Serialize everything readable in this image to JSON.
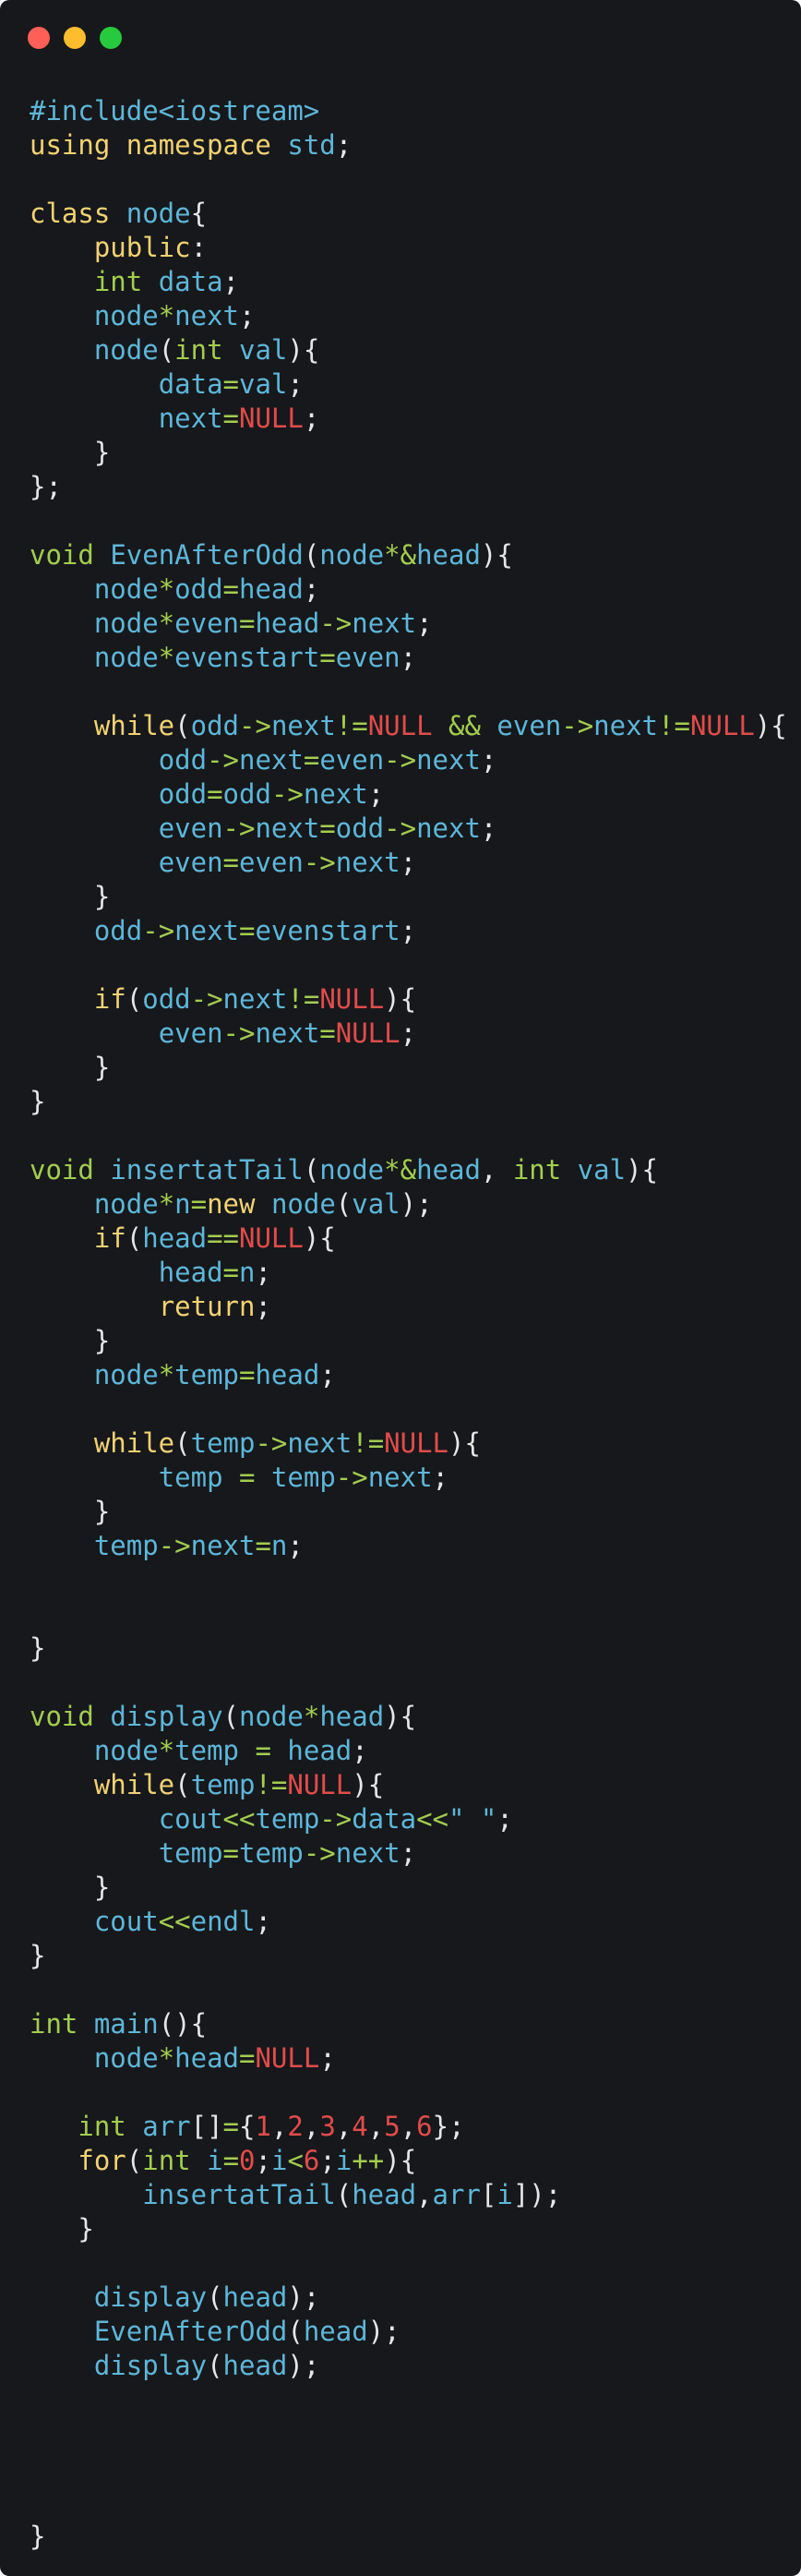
{
  "window": {
    "controls": [
      {
        "name": "close",
        "color": "#ff5f56"
      },
      {
        "name": "minimize",
        "color": "#ffbd2e"
      },
      {
        "name": "zoom",
        "color": "#27c93f"
      }
    ]
  },
  "colors": {
    "p": "#e6e6e6",
    "b": "#5eb6d9",
    "y": "#f2d272",
    "g": "#a3cd4f",
    "r": "#e24b4b",
    "background": "#16181b"
  },
  "code_lines": [
    [
      [
        "b",
        "#include<iostream>"
      ]
    ],
    [
      [
        "y",
        "using namespace "
      ],
      [
        "b",
        "std"
      ],
      [
        "p",
        ";"
      ]
    ],
    [],
    [
      [
        "y",
        "class "
      ],
      [
        "b",
        "node"
      ],
      [
        "p",
        "{"
      ]
    ],
    [
      [
        "p",
        "    "
      ],
      [
        "y",
        "public"
      ],
      [
        "p",
        ":"
      ]
    ],
    [
      [
        "p",
        "    "
      ],
      [
        "g",
        "int "
      ],
      [
        "b",
        "data"
      ],
      [
        "p",
        ";"
      ]
    ],
    [
      [
        "p",
        "    "
      ],
      [
        "b",
        "node"
      ],
      [
        "g",
        "*"
      ],
      [
        "b",
        "next"
      ],
      [
        "p",
        ";"
      ]
    ],
    [
      [
        "p",
        "    "
      ],
      [
        "b",
        "node"
      ],
      [
        "p",
        "("
      ],
      [
        "g",
        "int "
      ],
      [
        "b",
        "val"
      ],
      [
        "p",
        "){"
      ]
    ],
    [
      [
        "p",
        "        "
      ],
      [
        "b",
        "data"
      ],
      [
        "g",
        "="
      ],
      [
        "b",
        "val"
      ],
      [
        "p",
        ";"
      ]
    ],
    [
      [
        "p",
        "        "
      ],
      [
        "b",
        "next"
      ],
      [
        "g",
        "="
      ],
      [
        "r",
        "NULL"
      ],
      [
        "p",
        ";"
      ]
    ],
    [
      [
        "p",
        "    }"
      ]
    ],
    [
      [
        "p",
        "};"
      ]
    ],
    [],
    [
      [
        "g",
        "void "
      ],
      [
        "b",
        "EvenAfterOdd"
      ],
      [
        "p",
        "("
      ],
      [
        "b",
        "node"
      ],
      [
        "g",
        "*&"
      ],
      [
        "b",
        "head"
      ],
      [
        "p",
        "){"
      ]
    ],
    [
      [
        "p",
        "    "
      ],
      [
        "b",
        "node"
      ],
      [
        "g",
        "*"
      ],
      [
        "b",
        "odd"
      ],
      [
        "g",
        "="
      ],
      [
        "b",
        "head"
      ],
      [
        "p",
        ";"
      ]
    ],
    [
      [
        "p",
        "    "
      ],
      [
        "b",
        "node"
      ],
      [
        "g",
        "*"
      ],
      [
        "b",
        "even"
      ],
      [
        "g",
        "="
      ],
      [
        "b",
        "head"
      ],
      [
        "g",
        "->"
      ],
      [
        "b",
        "next"
      ],
      [
        "p",
        ";"
      ]
    ],
    [
      [
        "p",
        "    "
      ],
      [
        "b",
        "node"
      ],
      [
        "g",
        "*"
      ],
      [
        "b",
        "evenstart"
      ],
      [
        "g",
        "="
      ],
      [
        "b",
        "even"
      ],
      [
        "p",
        ";"
      ]
    ],
    [],
    [
      [
        "p",
        "    "
      ],
      [
        "y",
        "while"
      ],
      [
        "p",
        "("
      ],
      [
        "b",
        "odd"
      ],
      [
        "g",
        "->"
      ],
      [
        "b",
        "next"
      ],
      [
        "g",
        "!="
      ],
      [
        "r",
        "NULL"
      ],
      [
        "p",
        " "
      ],
      [
        "g",
        "&&"
      ],
      [
        "p",
        " "
      ],
      [
        "b",
        "even"
      ],
      [
        "g",
        "->"
      ],
      [
        "b",
        "next"
      ],
      [
        "g",
        "!="
      ],
      [
        "r",
        "NULL"
      ],
      [
        "p",
        "){"
      ]
    ],
    [
      [
        "p",
        "        "
      ],
      [
        "b",
        "odd"
      ],
      [
        "g",
        "->"
      ],
      [
        "b",
        "next"
      ],
      [
        "g",
        "="
      ],
      [
        "b",
        "even"
      ],
      [
        "g",
        "->"
      ],
      [
        "b",
        "next"
      ],
      [
        "p",
        ";"
      ]
    ],
    [
      [
        "p",
        "        "
      ],
      [
        "b",
        "odd"
      ],
      [
        "g",
        "="
      ],
      [
        "b",
        "odd"
      ],
      [
        "g",
        "->"
      ],
      [
        "b",
        "next"
      ],
      [
        "p",
        ";"
      ]
    ],
    [
      [
        "p",
        "        "
      ],
      [
        "b",
        "even"
      ],
      [
        "g",
        "->"
      ],
      [
        "b",
        "next"
      ],
      [
        "g",
        "="
      ],
      [
        "b",
        "odd"
      ],
      [
        "g",
        "->"
      ],
      [
        "b",
        "next"
      ],
      [
        "p",
        ";"
      ]
    ],
    [
      [
        "p",
        "        "
      ],
      [
        "b",
        "even"
      ],
      [
        "g",
        "="
      ],
      [
        "b",
        "even"
      ],
      [
        "g",
        "->"
      ],
      [
        "b",
        "next"
      ],
      [
        "p",
        ";"
      ]
    ],
    [
      [
        "p",
        "    }"
      ]
    ],
    [
      [
        "p",
        "    "
      ],
      [
        "b",
        "odd"
      ],
      [
        "g",
        "->"
      ],
      [
        "b",
        "next"
      ],
      [
        "g",
        "="
      ],
      [
        "b",
        "evenstart"
      ],
      [
        "p",
        ";"
      ]
    ],
    [],
    [
      [
        "p",
        "    "
      ],
      [
        "y",
        "if"
      ],
      [
        "p",
        "("
      ],
      [
        "b",
        "odd"
      ],
      [
        "g",
        "->"
      ],
      [
        "b",
        "next"
      ],
      [
        "g",
        "!="
      ],
      [
        "r",
        "NULL"
      ],
      [
        "p",
        "){"
      ]
    ],
    [
      [
        "p",
        "        "
      ],
      [
        "b",
        "even"
      ],
      [
        "g",
        "->"
      ],
      [
        "b",
        "next"
      ],
      [
        "g",
        "="
      ],
      [
        "r",
        "NULL"
      ],
      [
        "p",
        ";"
      ]
    ],
    [
      [
        "p",
        "    }"
      ]
    ],
    [
      [
        "p",
        "}"
      ]
    ],
    [],
    [
      [
        "g",
        "void "
      ],
      [
        "b",
        "insertatTail"
      ],
      [
        "p",
        "("
      ],
      [
        "b",
        "node"
      ],
      [
        "g",
        "*&"
      ],
      [
        "b",
        "head"
      ],
      [
        "p",
        ", "
      ],
      [
        "g",
        "int "
      ],
      [
        "b",
        "val"
      ],
      [
        "p",
        "){"
      ]
    ],
    [
      [
        "p",
        "    "
      ],
      [
        "b",
        "node"
      ],
      [
        "g",
        "*"
      ],
      [
        "b",
        "n"
      ],
      [
        "g",
        "="
      ],
      [
        "y",
        "new "
      ],
      [
        "b",
        "node"
      ],
      [
        "p",
        "("
      ],
      [
        "b",
        "val"
      ],
      [
        "p",
        ");"
      ]
    ],
    [
      [
        "p",
        "    "
      ],
      [
        "y",
        "if"
      ],
      [
        "p",
        "("
      ],
      [
        "b",
        "head"
      ],
      [
        "g",
        "=="
      ],
      [
        "r",
        "NULL"
      ],
      [
        "p",
        "){"
      ]
    ],
    [
      [
        "p",
        "        "
      ],
      [
        "b",
        "head"
      ],
      [
        "g",
        "="
      ],
      [
        "b",
        "n"
      ],
      [
        "p",
        ";"
      ]
    ],
    [
      [
        "p",
        "        "
      ],
      [
        "y",
        "return"
      ],
      [
        "p",
        ";"
      ]
    ],
    [
      [
        "p",
        "    }"
      ]
    ],
    [
      [
        "p",
        "    "
      ],
      [
        "b",
        "node"
      ],
      [
        "g",
        "*"
      ],
      [
        "b",
        "temp"
      ],
      [
        "g",
        "="
      ],
      [
        "b",
        "head"
      ],
      [
        "p",
        ";"
      ]
    ],
    [],
    [
      [
        "p",
        "    "
      ],
      [
        "y",
        "while"
      ],
      [
        "p",
        "("
      ],
      [
        "b",
        "temp"
      ],
      [
        "g",
        "->"
      ],
      [
        "b",
        "next"
      ],
      [
        "g",
        "!="
      ],
      [
        "r",
        "NULL"
      ],
      [
        "p",
        "){"
      ]
    ],
    [
      [
        "p",
        "        "
      ],
      [
        "b",
        "temp"
      ],
      [
        "p",
        " "
      ],
      [
        "g",
        "="
      ],
      [
        "p",
        " "
      ],
      [
        "b",
        "temp"
      ],
      [
        "g",
        "->"
      ],
      [
        "b",
        "next"
      ],
      [
        "p",
        ";"
      ]
    ],
    [
      [
        "p",
        "    }"
      ]
    ],
    [
      [
        "p",
        "    "
      ],
      [
        "b",
        "temp"
      ],
      [
        "g",
        "->"
      ],
      [
        "b",
        "next"
      ],
      [
        "g",
        "="
      ],
      [
        "b",
        "n"
      ],
      [
        "p",
        ";"
      ]
    ],
    [],
    [],
    [
      [
        "p",
        "}"
      ]
    ],
    [],
    [
      [
        "g",
        "void "
      ],
      [
        "b",
        "display"
      ],
      [
        "p",
        "("
      ],
      [
        "b",
        "node"
      ],
      [
        "g",
        "*"
      ],
      [
        "b",
        "head"
      ],
      [
        "p",
        "){"
      ]
    ],
    [
      [
        "p",
        "    "
      ],
      [
        "b",
        "node"
      ],
      [
        "g",
        "*"
      ],
      [
        "b",
        "temp"
      ],
      [
        "p",
        " "
      ],
      [
        "g",
        "="
      ],
      [
        "p",
        " "
      ],
      [
        "b",
        "head"
      ],
      [
        "p",
        ";"
      ]
    ],
    [
      [
        "p",
        "    "
      ],
      [
        "y",
        "while"
      ],
      [
        "p",
        "("
      ],
      [
        "b",
        "temp"
      ],
      [
        "g",
        "!="
      ],
      [
        "r",
        "NULL"
      ],
      [
        "p",
        "){"
      ]
    ],
    [
      [
        "p",
        "        "
      ],
      [
        "b",
        "cout"
      ],
      [
        "g",
        "<<"
      ],
      [
        "b",
        "temp"
      ],
      [
        "g",
        "->"
      ],
      [
        "b",
        "data"
      ],
      [
        "g",
        "<<"
      ],
      [
        "b",
        "\" \""
      ],
      [
        "p",
        ";"
      ]
    ],
    [
      [
        "p",
        "        "
      ],
      [
        "b",
        "temp"
      ],
      [
        "g",
        "="
      ],
      [
        "b",
        "temp"
      ],
      [
        "g",
        "->"
      ],
      [
        "b",
        "next"
      ],
      [
        "p",
        ";"
      ]
    ],
    [
      [
        "p",
        "    }"
      ]
    ],
    [
      [
        "p",
        "    "
      ],
      [
        "b",
        "cout"
      ],
      [
        "g",
        "<<"
      ],
      [
        "b",
        "endl"
      ],
      [
        "p",
        ";"
      ]
    ],
    [
      [
        "p",
        "}"
      ]
    ],
    [],
    [
      [
        "g",
        "int "
      ],
      [
        "b",
        "main"
      ],
      [
        "p",
        "(){"
      ]
    ],
    [
      [
        "p",
        "    "
      ],
      [
        "b",
        "node"
      ],
      [
        "g",
        "*"
      ],
      [
        "b",
        "head"
      ],
      [
        "g",
        "="
      ],
      [
        "r",
        "NULL"
      ],
      [
        "p",
        ";"
      ]
    ],
    [],
    [
      [
        "p",
        "   "
      ],
      [
        "g",
        "int "
      ],
      [
        "b",
        "arr"
      ],
      [
        "p",
        "[]"
      ],
      [
        "g",
        "="
      ],
      [
        "p",
        "{"
      ],
      [
        "r",
        "1"
      ],
      [
        "p",
        ","
      ],
      [
        "r",
        "2"
      ],
      [
        "p",
        ","
      ],
      [
        "r",
        "3"
      ],
      [
        "p",
        ","
      ],
      [
        "r",
        "4"
      ],
      [
        "p",
        ","
      ],
      [
        "r",
        "5"
      ],
      [
        "p",
        ","
      ],
      [
        "r",
        "6"
      ],
      [
        "p",
        "};"
      ]
    ],
    [
      [
        "p",
        "   "
      ],
      [
        "y",
        "for"
      ],
      [
        "p",
        "("
      ],
      [
        "g",
        "int "
      ],
      [
        "b",
        "i"
      ],
      [
        "g",
        "="
      ],
      [
        "r",
        "0"
      ],
      [
        "p",
        ";"
      ],
      [
        "b",
        "i"
      ],
      [
        "g",
        "<"
      ],
      [
        "r",
        "6"
      ],
      [
        "p",
        ";"
      ],
      [
        "b",
        "i"
      ],
      [
        "g",
        "++"
      ],
      [
        "p",
        "){"
      ]
    ],
    [
      [
        "p",
        "       "
      ],
      [
        "b",
        "insertatTail"
      ],
      [
        "p",
        "("
      ],
      [
        "b",
        "head"
      ],
      [
        "p",
        ","
      ],
      [
        "b",
        "arr"
      ],
      [
        "p",
        "["
      ],
      [
        "b",
        "i"
      ],
      [
        "p",
        "]);"
      ]
    ],
    [
      [
        "p",
        "   }"
      ]
    ],
    [],
    [
      [
        "p",
        "    "
      ],
      [
        "b",
        "display"
      ],
      [
        "p",
        "("
      ],
      [
        "b",
        "head"
      ],
      [
        "p",
        ");"
      ]
    ],
    [
      [
        "p",
        "    "
      ],
      [
        "b",
        "EvenAfterOdd"
      ],
      [
        "p",
        "("
      ],
      [
        "b",
        "head"
      ],
      [
        "p",
        ");"
      ]
    ],
    [
      [
        "p",
        "    "
      ],
      [
        "b",
        "display"
      ],
      [
        "p",
        "("
      ],
      [
        "b",
        "head"
      ],
      [
        "p",
        ");"
      ]
    ],
    [],
    [],
    [],
    [],
    [
      [
        "p",
        "}"
      ]
    ]
  ]
}
